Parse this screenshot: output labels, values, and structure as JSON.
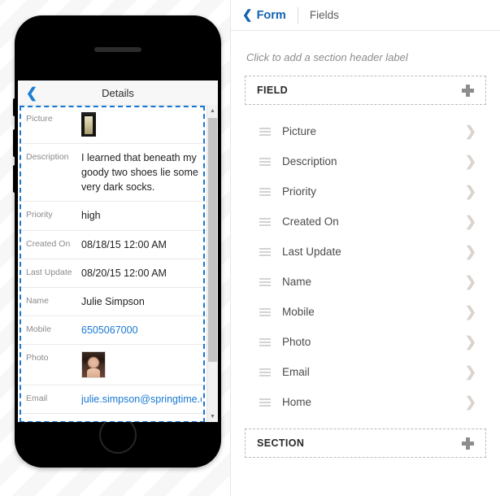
{
  "editor": {
    "breadcrumb": {
      "back_icon": "chevron-left-icon",
      "back_label": "Form",
      "current_label": "Fields"
    },
    "section_hint": "Click to add a section header label",
    "field_header": {
      "label": "FIELD",
      "add_icon": "plus-icon"
    },
    "section_footer": {
      "label": "SECTION",
      "add_icon": "plus-icon"
    },
    "fields": [
      {
        "name": "Picture"
      },
      {
        "name": "Description"
      },
      {
        "name": "Priority"
      },
      {
        "name": "Created On"
      },
      {
        "name": "Last Update"
      },
      {
        "name": "Name"
      },
      {
        "name": "Mobile"
      },
      {
        "name": "Photo"
      },
      {
        "name": "Email"
      },
      {
        "name": "Home"
      }
    ]
  },
  "preview": {
    "screen": {
      "back_icon": "chevron-left-icon",
      "title": "Details",
      "rows": [
        {
          "label": "Picture",
          "value": "",
          "kind": "image-picture"
        },
        {
          "label": "Description",
          "value": "I learned that beneath my goody two shoes lie some very dark socks.",
          "kind": "text-wrap"
        },
        {
          "label": "Priority",
          "value": "high",
          "kind": "text"
        },
        {
          "label": "Created On",
          "value": "08/18/15 12:00 AM",
          "kind": "text"
        },
        {
          "label": "Last Update",
          "value": "08/20/15 12:00 AM",
          "kind": "text"
        },
        {
          "label": "Name",
          "value": "Julie Simpson",
          "kind": "text"
        },
        {
          "label": "Mobile",
          "value": "6505067000",
          "kind": "link"
        },
        {
          "label": "Photo",
          "value": "",
          "kind": "image-photo"
        },
        {
          "label": "Email",
          "value": "julie.simpson@springtime.co",
          "kind": "link"
        }
      ]
    },
    "scrollbar": {
      "up_arrow": "triangle-up-icon",
      "down_arrow": "triangle-down-icon"
    }
  },
  "colors": {
    "accent_blue": "#1263b0",
    "link_blue": "#1878d2",
    "selection_blue": "#1878d2",
    "chevron_gray": "#d9d4cd"
  }
}
